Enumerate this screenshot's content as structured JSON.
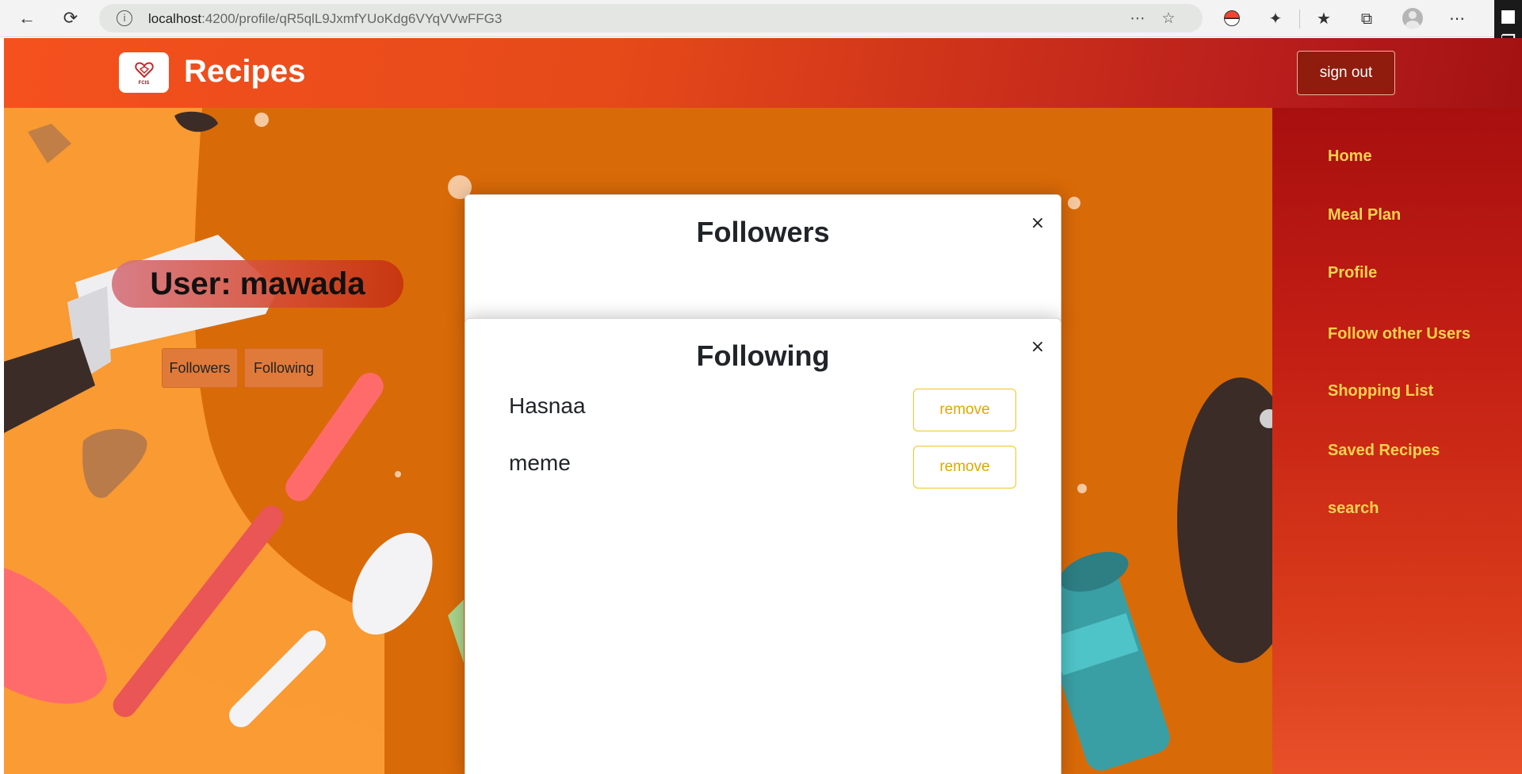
{
  "browser": {
    "url_host": "localhost",
    "url_path": ":4200/profile/qR5qlL9JxmfYUoKdg6VYqVVwFFG3"
  },
  "header": {
    "logo_text": "FCIS",
    "brand": "Recipes",
    "signout_label": "sign out"
  },
  "sidebar": {
    "items": [
      {
        "label": "Home"
      },
      {
        "label": "Meal Plan"
      },
      {
        "label": "Profile"
      },
      {
        "label": "Follow other Users"
      },
      {
        "label": "Shopping List"
      },
      {
        "label": "Saved Recipes"
      },
      {
        "label": "search"
      }
    ]
  },
  "profile": {
    "user_label": "User: mawada",
    "followers_button": "Followers",
    "following_button": "Following"
  },
  "followers_modal": {
    "title": "Followers",
    "close": "×"
  },
  "following_modal": {
    "title": "Following",
    "close": "×",
    "users": [
      {
        "name": "Hasnaa",
        "action": "remove"
      },
      {
        "name": "meme",
        "action": "remove"
      }
    ]
  },
  "colors": {
    "header_start": "#f4511e",
    "header_end": "#a31212",
    "sidebar_link": "#fbd34d",
    "remove_border": "#f2c521",
    "bg_orange": "#d96a08"
  }
}
